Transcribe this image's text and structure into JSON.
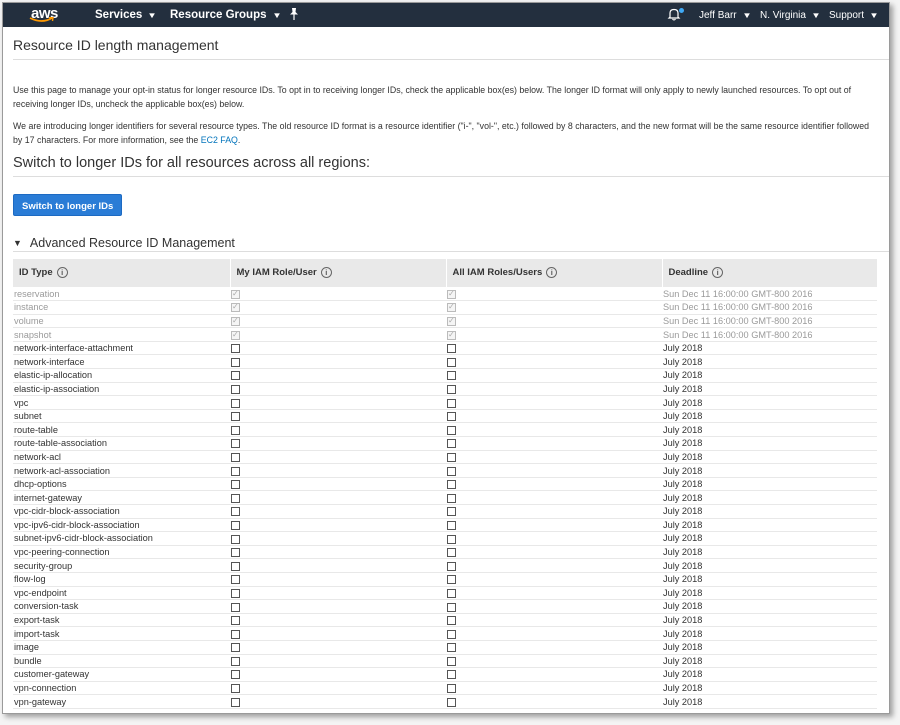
{
  "nav": {
    "logo": "aws",
    "services": "Services",
    "resource_groups": "Resource Groups",
    "user": "Jeff Barr",
    "region": "N. Virginia",
    "support": "Support"
  },
  "page": {
    "title": "Resource ID length management",
    "intro_1": "Use this page to manage your opt-in status for longer resource IDs. To opt in to receiving longer IDs, check the applicable box(es) below. The longer ID format will only apply to newly launched resources. To opt out of receiving longer IDs, uncheck the applicable box(es) below.",
    "intro_2_text": "We are introducing longer identifiers for several resource types. The old resource ID format is a resource identifier (\"i-\", \"vol-\", etc.) followed by 8 characters, and the new format will be the same resource identifier followed by 17 characters. For more information, see the ",
    "intro_2_link": "EC2 FAQ",
    "intro_2_end": ".",
    "switch_heading": "Switch to longer IDs for all resources across all regions:",
    "switch_button": "Switch to longer IDs",
    "advanced_heading": "Advanced Resource ID Management"
  },
  "table": {
    "headers": [
      "ID Type",
      "My IAM Role/User",
      "All IAM Roles/Users",
      "Deadline"
    ],
    "rows": [
      {
        "id": "reservation",
        "mine": true,
        "all": true,
        "deadline": "Sun Dec 11 16:00:00 GMT-800 2016",
        "disabled": true
      },
      {
        "id": "instance",
        "mine": true,
        "all": true,
        "deadline": "Sun Dec 11 16:00:00 GMT-800 2016",
        "disabled": true
      },
      {
        "id": "volume",
        "mine": true,
        "all": true,
        "deadline": "Sun Dec 11 16:00:00 GMT-800 2016",
        "disabled": true
      },
      {
        "id": "snapshot",
        "mine": true,
        "all": true,
        "deadline": "Sun Dec 11 16:00:00 GMT-800 2016",
        "disabled": true
      },
      {
        "id": "network-interface-attachment",
        "mine": false,
        "all": false,
        "deadline": "July 2018",
        "disabled": false
      },
      {
        "id": "network-interface",
        "mine": false,
        "all": false,
        "deadline": "July 2018",
        "disabled": false
      },
      {
        "id": "elastic-ip-allocation",
        "mine": false,
        "all": false,
        "deadline": "July 2018",
        "disabled": false
      },
      {
        "id": "elastic-ip-association",
        "mine": false,
        "all": false,
        "deadline": "July 2018",
        "disabled": false
      },
      {
        "id": "vpc",
        "mine": false,
        "all": false,
        "deadline": "July 2018",
        "disabled": false
      },
      {
        "id": "subnet",
        "mine": false,
        "all": false,
        "deadline": "July 2018",
        "disabled": false
      },
      {
        "id": "route-table",
        "mine": false,
        "all": false,
        "deadline": "July 2018",
        "disabled": false
      },
      {
        "id": "route-table-association",
        "mine": false,
        "all": false,
        "deadline": "July 2018",
        "disabled": false
      },
      {
        "id": "network-acl",
        "mine": false,
        "all": false,
        "deadline": "July 2018",
        "disabled": false
      },
      {
        "id": "network-acl-association",
        "mine": false,
        "all": false,
        "deadline": "July 2018",
        "disabled": false
      },
      {
        "id": "dhcp-options",
        "mine": false,
        "all": false,
        "deadline": "July 2018",
        "disabled": false
      },
      {
        "id": "internet-gateway",
        "mine": false,
        "all": false,
        "deadline": "July 2018",
        "disabled": false
      },
      {
        "id": "vpc-cidr-block-association",
        "mine": false,
        "all": false,
        "deadline": "July 2018",
        "disabled": false
      },
      {
        "id": "vpc-ipv6-cidr-block-association",
        "mine": false,
        "all": false,
        "deadline": "July 2018",
        "disabled": false
      },
      {
        "id": "subnet-ipv6-cidr-block-association",
        "mine": false,
        "all": false,
        "deadline": "July 2018",
        "disabled": false
      },
      {
        "id": "vpc-peering-connection",
        "mine": false,
        "all": false,
        "deadline": "July 2018",
        "disabled": false
      },
      {
        "id": "security-group",
        "mine": false,
        "all": false,
        "deadline": "July 2018",
        "disabled": false
      },
      {
        "id": "flow-log",
        "mine": false,
        "all": false,
        "deadline": "July 2018",
        "disabled": false
      },
      {
        "id": "vpc-endpoint",
        "mine": false,
        "all": false,
        "deadline": "July 2018",
        "disabled": false
      },
      {
        "id": "conversion-task",
        "mine": false,
        "all": false,
        "deadline": "July 2018",
        "disabled": false
      },
      {
        "id": "export-task",
        "mine": false,
        "all": false,
        "deadline": "July 2018",
        "disabled": false
      },
      {
        "id": "import-task",
        "mine": false,
        "all": false,
        "deadline": "July 2018",
        "disabled": false
      },
      {
        "id": "image",
        "mine": false,
        "all": false,
        "deadline": "July 2018",
        "disabled": false
      },
      {
        "id": "bundle",
        "mine": false,
        "all": false,
        "deadline": "July 2018",
        "disabled": false
      },
      {
        "id": "customer-gateway",
        "mine": false,
        "all": false,
        "deadline": "July 2018",
        "disabled": false
      },
      {
        "id": "vpn-connection",
        "mine": false,
        "all": false,
        "deadline": "July 2018",
        "disabled": false
      },
      {
        "id": "vpn-gateway",
        "mine": false,
        "all": false,
        "deadline": "July 2018",
        "disabled": false
      }
    ]
  },
  "colors": {
    "nav_bg": "#232f3e",
    "primary_button": "#2a7cd6",
    "link": "#0073bb",
    "notification_dot": "#3fa9f5"
  }
}
